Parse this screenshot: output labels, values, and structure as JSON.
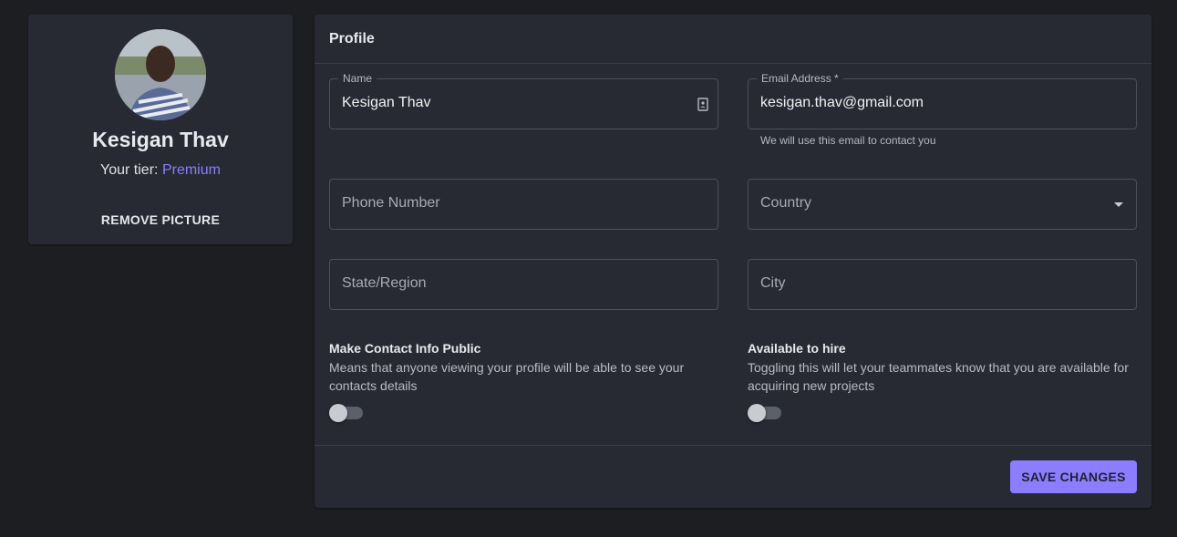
{
  "profile": {
    "name": "Kesigan Thav",
    "tier_label": "Your tier:",
    "tier_value": "Premium",
    "remove_picture_label": "REMOVE PICTURE"
  },
  "form": {
    "title": "Profile",
    "name_field": {
      "label": "Name",
      "value": "Kesigan Thav"
    },
    "email_field": {
      "label": "Email Address *",
      "value": "kesigan.thav@gmail.com",
      "helper": "We will use this email to contact you"
    },
    "phone_field": {
      "placeholder": "Phone Number"
    },
    "country_field": {
      "placeholder": "Country"
    },
    "state_field": {
      "placeholder": "State/Region"
    },
    "city_field": {
      "placeholder": "City"
    },
    "contact_public": {
      "title": "Make Contact Info Public",
      "description": "Means that anyone viewing your profile will be able to see your contacts details",
      "enabled": false
    },
    "available_hire": {
      "title": "Available to hire",
      "description": "Toggling this will let your teammates know that you are available for acquiring new projects",
      "enabled": false
    },
    "save_label": "SAVE CHANGES"
  },
  "icons": {
    "name_field_icon": "contact-card-icon",
    "country_field_icon": "caret-down-icon"
  },
  "colors": {
    "background": "#1c1e22",
    "card": "#272a33",
    "accent": "#8b7dfd"
  }
}
